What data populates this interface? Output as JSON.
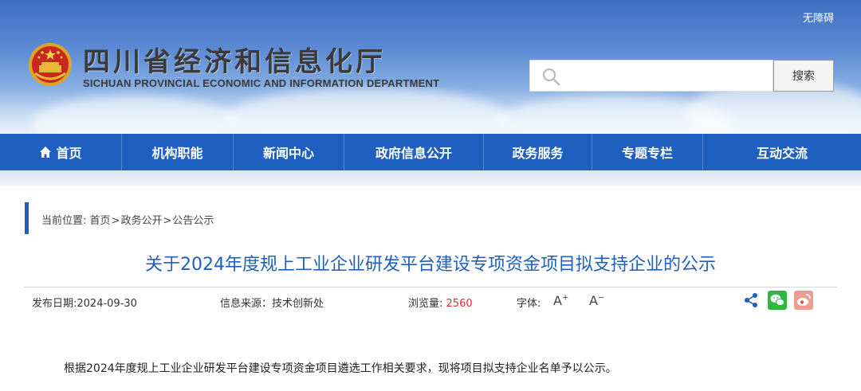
{
  "header": {
    "accessibility_link": "无障碍",
    "site_title": "四川省经济和信息化厅",
    "site_subtitle": "SICHUAN PROVINCIAL ECONOMIC AND INFORMATION DEPARTMENT",
    "search": {
      "placeholder": "",
      "value": "",
      "button_label": "搜索"
    }
  },
  "nav": {
    "items": [
      {
        "label": "首页",
        "icon": "home-icon"
      },
      {
        "label": "机构职能"
      },
      {
        "label": "新闻中心"
      },
      {
        "label": "政府信息公开"
      },
      {
        "label": "政务服务"
      },
      {
        "label": "专题专栏"
      },
      {
        "label": "互动交流"
      }
    ]
  },
  "breadcrumb": {
    "prefix": "当前位置:",
    "items": [
      "首页",
      "政务公开",
      "公告公示"
    ],
    "separator": ">"
  },
  "article": {
    "title": "关于2024年度规上工业企业研发平台建设专项资金项目拟支持企业的公示",
    "publish_date_label": "发布日期:",
    "publish_date": "2024-09-30",
    "source_label": "信息来源：",
    "source": "技术创新处",
    "views_label": "浏览量:",
    "views": "2560",
    "font_label": "字体:",
    "font_increase": "A",
    "font_decrease": "A",
    "body": "根据2024年度规上工业企业研发平台建设专项资金项目遴选工作相关要求，现将项目拟支持企业名单予以公示。"
  },
  "colors": {
    "brand_blue": "#1f5fbf",
    "title_blue": "#1f5fbf",
    "views_red": "#e02a2a",
    "wechat_green": "#2db741",
    "weibo_pink": "#f19c93"
  }
}
